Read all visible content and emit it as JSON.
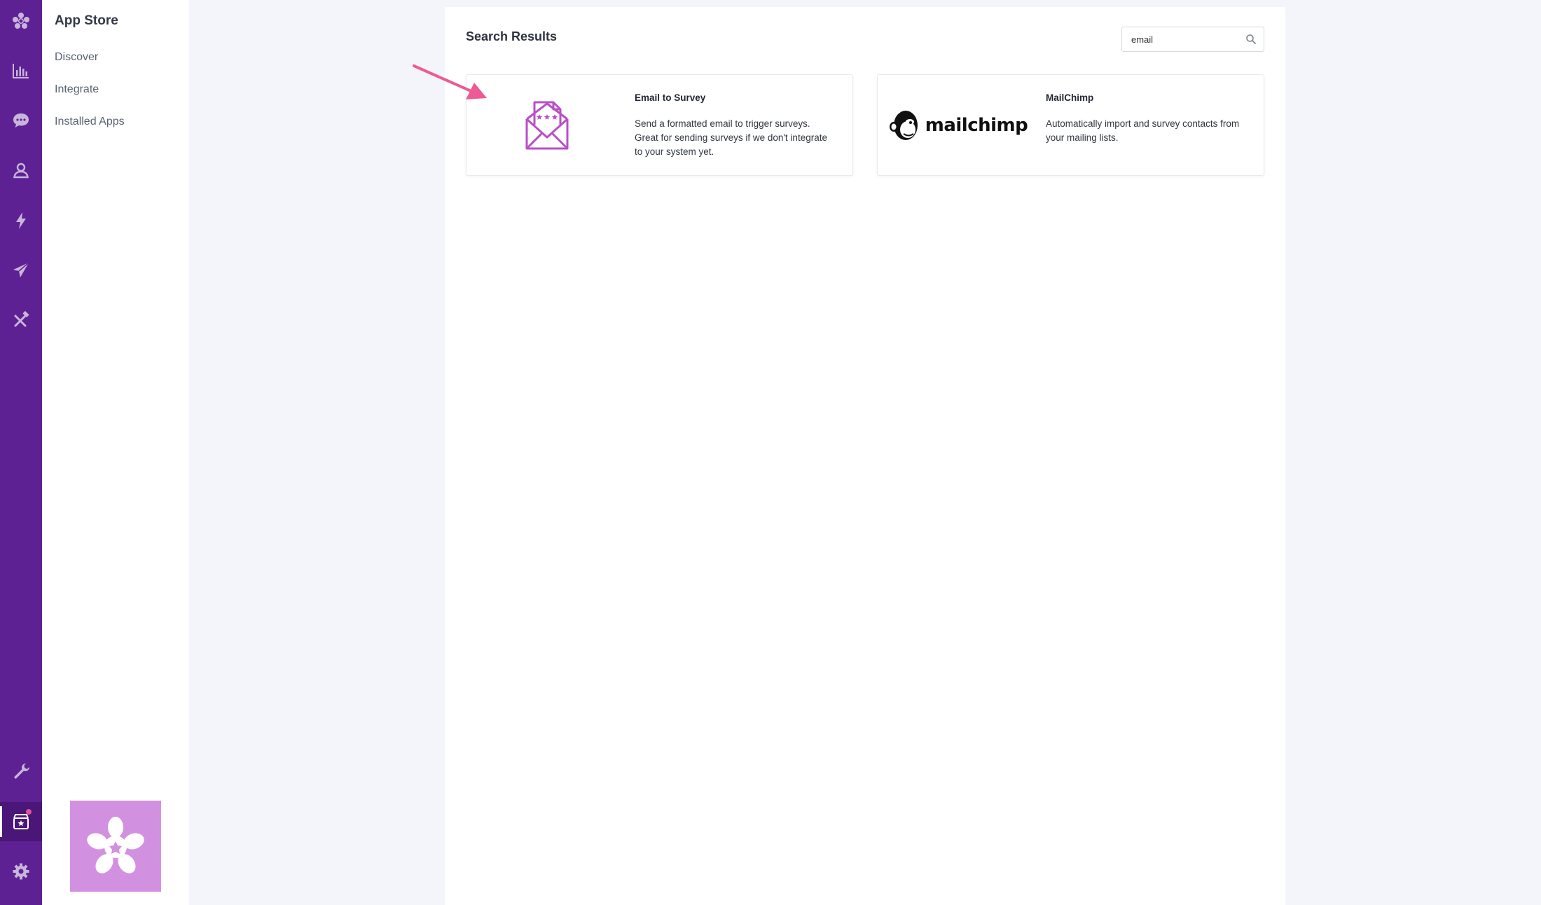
{
  "rail": {
    "top_icons": [
      "flower-logo-icon",
      "bar-chart-icon",
      "chat-bubble-icon",
      "user-icon",
      "lightning-icon",
      "paper-plane-icon",
      "tools-icon"
    ],
    "bottom_icons": [
      "wrench-icon",
      "app-store-icon",
      "gear-icon"
    ],
    "color": "#5e2194"
  },
  "subnav": {
    "title": "App Store",
    "items": [
      {
        "label": "Discover"
      },
      {
        "label": "Integrate"
      },
      {
        "label": "Installed Apps"
      }
    ]
  },
  "main": {
    "title": "Search Results",
    "search": {
      "value": "email",
      "icon": "search-icon"
    },
    "results": [
      {
        "name": "Email to Survey",
        "description": "Send a formatted email to trigger surveys. Great for sending surveys if we don't integrate to your system yet.",
        "icon": "email-survey-icon",
        "accent": "#b94fc7"
      },
      {
        "name": "MailChimp",
        "description": "Automatically import and survey contacts from your mailing lists.",
        "logo_text": "mailchimp",
        "icon": "mailchimp-logo"
      }
    ]
  },
  "annotation": {
    "color": "#ee5a95"
  },
  "colors": {
    "brand_purple": "#5e2194",
    "logo_tile": "#d291e0",
    "notification": "#e0529c"
  }
}
